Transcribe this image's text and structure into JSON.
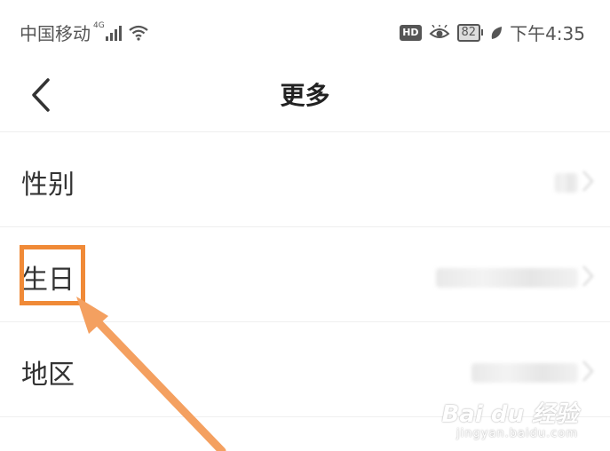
{
  "status_bar": {
    "carrier": "中国移动",
    "network": "4G",
    "hd": "HD",
    "battery": "82",
    "time": "下午4:35"
  },
  "nav": {
    "title": "更多"
  },
  "rows": [
    {
      "label": "性别"
    },
    {
      "label": "生日"
    },
    {
      "label": "地区"
    }
  ],
  "watermark": {
    "main": "Bai du 经验",
    "sub": "jingyan.baidu.com"
  },
  "colors": {
    "highlight": "#f08a37",
    "divider": "#efefef"
  }
}
